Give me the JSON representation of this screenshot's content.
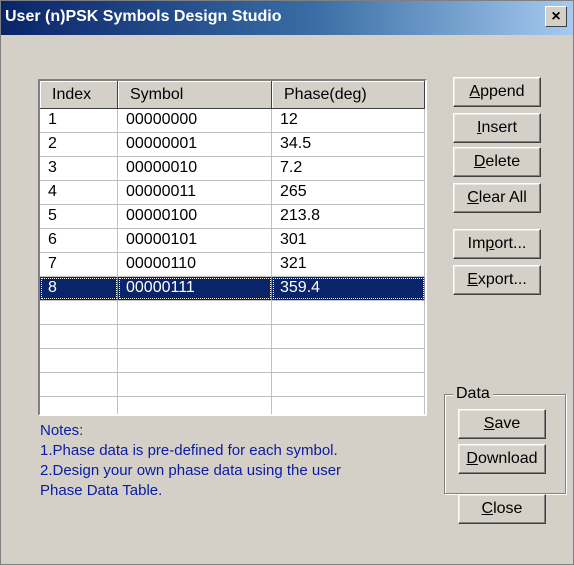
{
  "window": {
    "title": "User (n)PSK Symbols Design Studio",
    "close_glyph": "×"
  },
  "table": {
    "columns": [
      "Index",
      "Symbol",
      "Phase(deg)"
    ],
    "rows": [
      [
        "1",
        "00000000",
        "12"
      ],
      [
        "2",
        "00000001",
        "34.5"
      ],
      [
        "3",
        "00000010",
        "7.2"
      ],
      [
        "4",
        "00000011",
        "265"
      ],
      [
        "5",
        "00000100",
        "213.8"
      ],
      [
        "6",
        "00000101",
        "301"
      ],
      [
        "7",
        "00000110",
        "321"
      ],
      [
        "8",
        "00000111",
        "359.4"
      ]
    ],
    "selected_row_index": 7,
    "empty_rows": 5
  },
  "notes": {
    "lines": [
      "Notes:",
      "1.Phase data is pre-defined for each symbol.",
      "2.Design your own phase data using the user",
      "Phase Data Table."
    ]
  },
  "buttons": {
    "append": {
      "mnemonic": "A",
      "rest": "ppend"
    },
    "insert": {
      "mnemonic": "I",
      "rest": "nsert"
    },
    "delete": {
      "mnemonic": "D",
      "rest": "elete"
    },
    "clear_all": {
      "mnemonic": "C",
      "rest": "lear All"
    },
    "import": {
      "pre": "Im",
      "mnemonic": "p",
      "rest": "ort..."
    },
    "export": {
      "mnemonic": "E",
      "rest": "xport..."
    },
    "save": {
      "mnemonic": "S",
      "rest": "ave"
    },
    "download": {
      "mnemonic": "D",
      "rest": "ownload"
    },
    "close": {
      "mnemonic": "C",
      "rest": "lose"
    }
  },
  "data_group": {
    "label": "Data"
  },
  "colors": {
    "title_bar": "#0a246a",
    "selection": "#0a246a",
    "notes_text": "#0a1ca0",
    "face": "#d4d0c8"
  }
}
